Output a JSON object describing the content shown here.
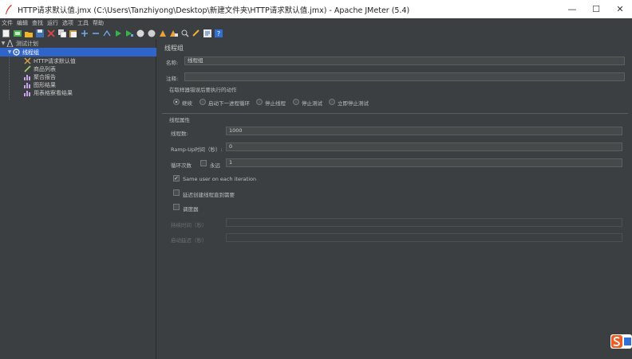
{
  "window": {
    "title": "HTTP请求默认值.jmx (C:\\Users\\Tanzhiyong\\Desktop\\新建文件夹\\HTTP请求默认值.jmx) - Apache JMeter (5.4)",
    "minimize": "—",
    "maximize": "☐",
    "close": "✕"
  },
  "menu": [
    "文件",
    "编辑",
    "查找",
    "运行",
    "选项",
    "工具",
    "帮助"
  ],
  "tree": {
    "root": "测试计划",
    "thread_group": "线程组",
    "children": [
      "HTTP请求默认值",
      "商品列表",
      "聚合报告",
      "图形结果",
      "用表格察看结果"
    ]
  },
  "panel": {
    "title": "线程组",
    "name_label": "名称:",
    "name_value": "线程组",
    "comment_label": "注释:",
    "comment_value": "",
    "error_action_label": "在取样器错误后要执行的动作",
    "error_actions": [
      "继续",
      "启动下一进程循环",
      "停止线程",
      "停止测试",
      "立即停止测试"
    ],
    "thread_props_label": "线程属性",
    "threads_label": "线程数:",
    "threads_value": "1000",
    "rampup_label": "Ramp-Up时间（秒）:",
    "rampup_value": "0",
    "loop_label": "循环次数",
    "forever_label": "永远",
    "loop_value": "1",
    "same_user_label": "Same user on each iteration",
    "delay_label": "延迟创建线程直到需要",
    "scheduler_label": "调度器",
    "duration_label": "持续时间（秒）",
    "startup_delay_label": "启动延迟（秒）"
  },
  "colors": {
    "selection": "#2f65ca",
    "background": "#3c3f41"
  }
}
